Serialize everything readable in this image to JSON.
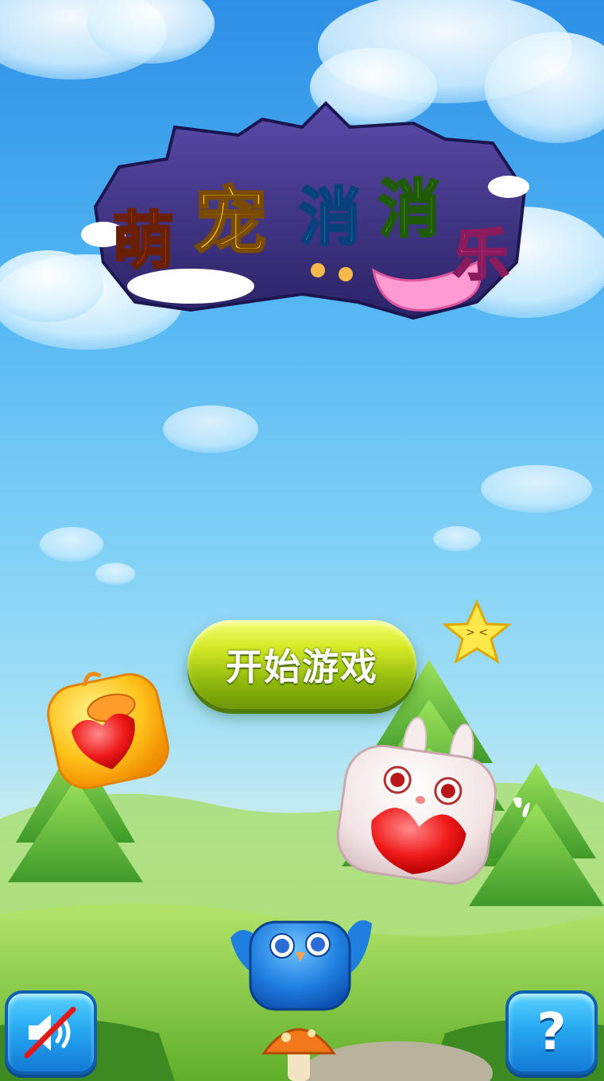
{
  "game": {
    "title": "萌宠消消乐",
    "title_chars": [
      "萌",
      "宠",
      "消",
      "消",
      "乐"
    ]
  },
  "menu": {
    "start_label": "开始游戏"
  },
  "controls": {
    "sound": {
      "icon": "speaker-muted-icon",
      "state": "muted"
    },
    "help": {
      "icon": "question-mark-icon",
      "label": "?"
    }
  },
  "colors": {
    "sky_top": "#2d8fe6",
    "start_button": "#b9d41a",
    "corner_button": "#27a9f2",
    "title_char_1": "#ff6b2c",
    "title_char_2": "#ffd21e",
    "title_char_3": "#2fc3ff",
    "title_char_4": "#7fe04a",
    "title_char_5": "#ff7ec8"
  }
}
